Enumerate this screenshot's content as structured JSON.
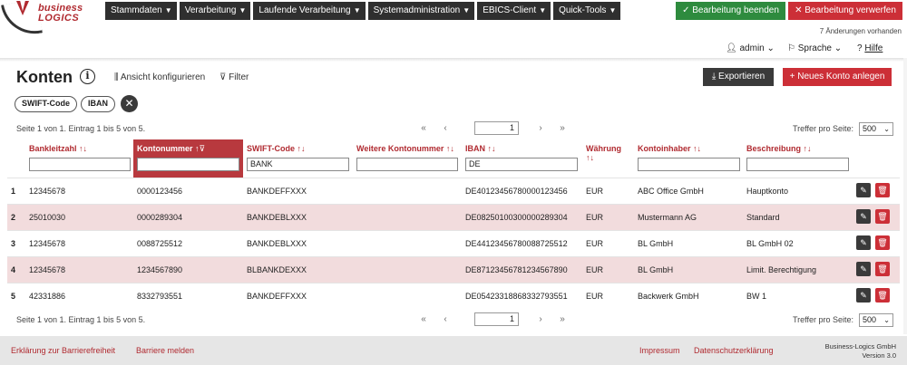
{
  "app": {
    "logo_line1": "business",
    "logo_line2": "LOGICS",
    "accent_color": "#b02a30",
    "success_color": "#2e8b3e",
    "danger_color": "#cc2f37"
  },
  "nav": {
    "items": [
      {
        "label": "Stammdaten"
      },
      {
        "label": "Verarbeitung"
      },
      {
        "label": "Laufende Verarbeitung"
      },
      {
        "label": "Systemadministration"
      },
      {
        "label": "EBICS-Client"
      },
      {
        "label": "Quick-Tools"
      }
    ]
  },
  "actions": {
    "finish_label": "✓ Bearbeitung beenden",
    "discard_label": "✕ Bearbeitung verwerfen",
    "changes_text": "7 Änderungen vorhanden"
  },
  "userbar": {
    "user": "admin",
    "language": "Sprache",
    "help": "Hilfe"
  },
  "page": {
    "title": "Konten",
    "info_icon": "i",
    "configure_view": "Ansicht konfigurieren",
    "filter": "Filter",
    "export": "Exportieren",
    "new_account": "Neues Konto anlegen"
  },
  "chips": [
    "SWIFT-Code",
    "IBAN"
  ],
  "pagination": {
    "info": "Seite 1 von 1. Eintrag 1 bis 5 von 5.",
    "first": "«",
    "prev": "‹",
    "page": "1",
    "next": "›",
    "last": "»",
    "per_page_label": "Treffer pro Seite:",
    "per_page": "500"
  },
  "columns": [
    {
      "label": "Bankleitzahl",
      "filter": ""
    },
    {
      "label": "Kontonummer",
      "filter": ""
    },
    {
      "label": "SWIFT-Code",
      "filter": "BANK"
    },
    {
      "label": "Weitere Kontonummer",
      "filter": ""
    },
    {
      "label": "IBAN",
      "filter": "DE"
    },
    {
      "label": "Währung",
      "filter": ""
    },
    {
      "label": "Kontoinhaber",
      "filter": ""
    },
    {
      "label": "Beschreibung",
      "filter": ""
    }
  ],
  "rows": [
    {
      "n": "1",
      "blz": "12345678",
      "konto": "0000123456",
      "swift": "BANKDEFFXXX",
      "weitere": "",
      "iban": "DE40123456780000123456",
      "waehrung": "EUR",
      "inhaber": "ABC Office GmbH",
      "beschreibung": "Hauptkonto"
    },
    {
      "n": "2",
      "blz": "25010030",
      "konto": "0000289304",
      "swift": "BANKDEBLXXX",
      "weitere": "",
      "iban": "DE08250100300000289304",
      "waehrung": "EUR",
      "inhaber": "Mustermann AG",
      "beschreibung": "Standard"
    },
    {
      "n": "3",
      "blz": "12345678",
      "konto": "0088725512",
      "swift": "BANKDEBLXXX",
      "weitere": "",
      "iban": "DE44123456780088725512",
      "waehrung": "EUR",
      "inhaber": "BL GmbH",
      "beschreibung": "BL GmbH 02"
    },
    {
      "n": "4",
      "blz": "12345678",
      "konto": "1234567890",
      "swift": "BLBANKDEXXX",
      "weitere": "",
      "iban": "DE87123456781234567890",
      "waehrung": "EUR",
      "inhaber": "BL GmbH",
      "beschreibung": "Limit. Berechtigung"
    },
    {
      "n": "5",
      "blz": "42331886",
      "konto": "8332793551",
      "swift": "BANKDEFFXXX",
      "weitere": "",
      "iban": "DE05423318868332793551",
      "waehrung": "EUR",
      "inhaber": "Backwerk GmbH",
      "beschreibung": "BW 1"
    }
  ],
  "footer": {
    "accessibility": "Erklärung zur Barrierefreiheit",
    "report": "Barriere melden",
    "impressum": "Impressum",
    "privacy": "Datenschutzerklärung",
    "company": "Business-Logics GmbH",
    "version": "Version 3.0"
  }
}
